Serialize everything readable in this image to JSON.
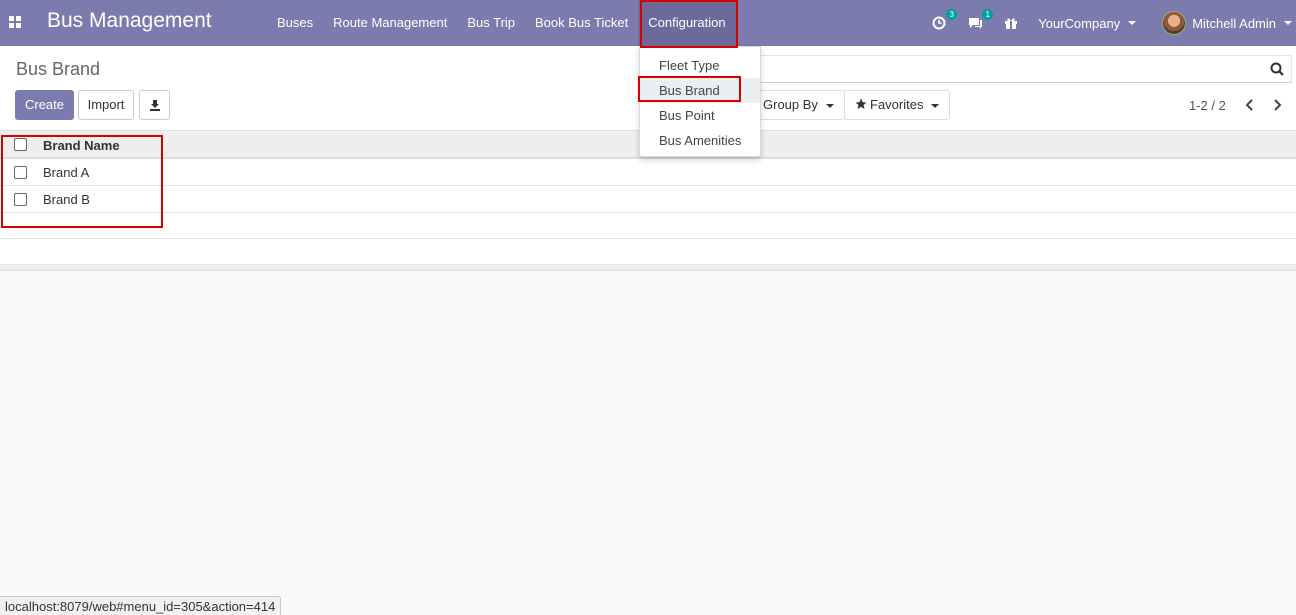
{
  "navbar": {
    "app_title": "Bus Management",
    "menu": [
      "Buses",
      "Route Management",
      "Bus Trip",
      "Book Bus Ticket",
      "Configuration"
    ],
    "activity_count": "3",
    "message_count": "1",
    "company": "YourCompany",
    "user": "Mitchell Admin"
  },
  "control_panel": {
    "breadcrumb": "Bus Brand",
    "create_label": "Create",
    "import_label": "Import",
    "group_by_label": "Group By",
    "favorites_label": "Favorites",
    "pager": "1-2 / 2"
  },
  "dropdown": {
    "items": [
      "Fleet Type",
      "Bus Brand",
      "Bus Point",
      "Bus Amenities"
    ],
    "highlighted": "Bus Brand"
  },
  "table": {
    "column_header": "Brand Name",
    "rows": [
      "Brand A",
      "Brand B"
    ]
  },
  "statusbar": {
    "url": "localhost:8079/web#menu_id=305&action=414"
  },
  "colors": {
    "navbar": "#7c7bad",
    "primary_button": "#7c7bad",
    "highlight_border": "#d60000",
    "badge": "#00a09d"
  }
}
